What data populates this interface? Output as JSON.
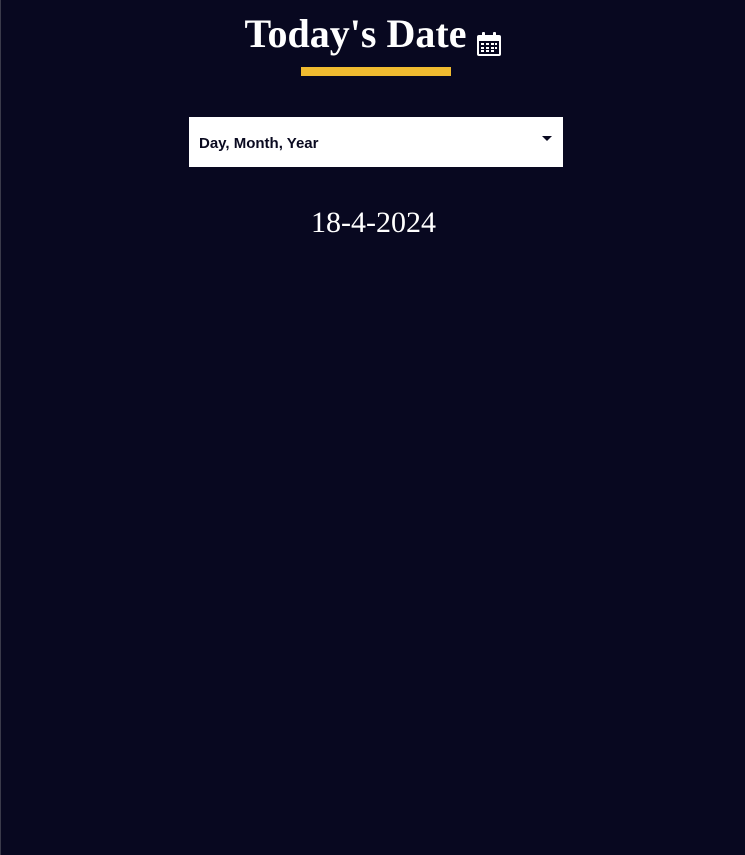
{
  "header": {
    "title": "Today's Date",
    "icon": "calendar-icon"
  },
  "colors": {
    "background": "#080820",
    "accent": "#f0bb30"
  },
  "format_select": {
    "selected": "Day, Month, Year"
  },
  "date_display": {
    "value": "18-4-2024"
  }
}
